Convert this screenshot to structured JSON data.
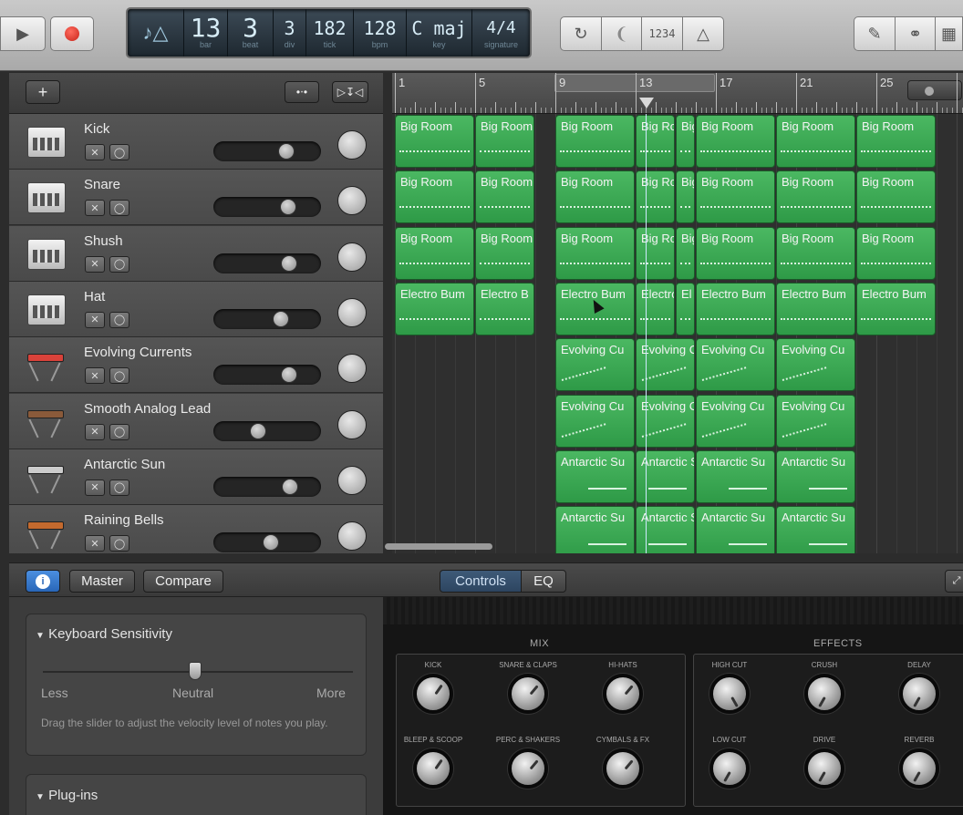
{
  "transport": {
    "play_icon": "play-icon",
    "record_icon": "record-icon"
  },
  "lcd": {
    "bar": {
      "value": "13",
      "label": "bar"
    },
    "beat": {
      "value": "3",
      "label": "beat"
    },
    "div": {
      "value": "3",
      "label": "div"
    },
    "tick": {
      "value": "182",
      "label": "tick"
    },
    "bpm": {
      "value": "128",
      "label": "bpm"
    },
    "key": {
      "value": "C maj",
      "label": "key"
    },
    "signature": {
      "value": "4/4",
      "label": "signature"
    }
  },
  "toolbar": {
    "count_in_label": "1234"
  },
  "ruler": {
    "bars": [
      "1",
      "5",
      "9",
      "13",
      "17",
      "21",
      "25"
    ]
  },
  "tracks": [
    {
      "name": "Kick",
      "volume": 0.72
    },
    {
      "name": "Snare",
      "volume": 0.74
    },
    {
      "name": "Shush",
      "volume": 0.76
    },
    {
      "name": "Hat",
      "volume": 0.66
    },
    {
      "name": "Evolving Currents",
      "volume": 0.75
    },
    {
      "name": "Smooth Analog Lead",
      "volume": 0.41
    },
    {
      "name": "Antarctic Sun",
      "volume": 0.77
    },
    {
      "name": "Raining Bells",
      "volume": 0.55
    }
  ],
  "regions": [
    {
      "track": 0,
      "label": "Big Room",
      "start": 1,
      "end": 5
    },
    {
      "track": 0,
      "label": "Big Room",
      "start": 5,
      "end": 8
    },
    {
      "track": 0,
      "label": "Big Room",
      "start": 9,
      "end": 13
    },
    {
      "track": 0,
      "label": "Big Room",
      "start": 13,
      "end": 15
    },
    {
      "track": 0,
      "label": "Big Room",
      "start": 15,
      "end": 16
    },
    {
      "track": 0,
      "label": "Big Room",
      "start": 16,
      "end": 20
    },
    {
      "track": 0,
      "label": "Big Room",
      "start": 20,
      "end": 24
    },
    {
      "track": 0,
      "label": "Big Room",
      "start": 24,
      "end": 28
    },
    {
      "track": 1,
      "label": "Big Room",
      "start": 1,
      "end": 5
    },
    {
      "track": 1,
      "label": "Big Room",
      "start": 5,
      "end": 8
    },
    {
      "track": 1,
      "label": "Big Room",
      "start": 9,
      "end": 13
    },
    {
      "track": 1,
      "label": "Big Room",
      "start": 13,
      "end": 15
    },
    {
      "track": 1,
      "label": "Big Room",
      "start": 15,
      "end": 16
    },
    {
      "track": 1,
      "label": "Big Room",
      "start": 16,
      "end": 20
    },
    {
      "track": 1,
      "label": "Big Room",
      "start": 20,
      "end": 24
    },
    {
      "track": 1,
      "label": "Big Room",
      "start": 24,
      "end": 28
    },
    {
      "track": 2,
      "label": "Big Room",
      "start": 1,
      "end": 5
    },
    {
      "track": 2,
      "label": "Big Room",
      "start": 5,
      "end": 8
    },
    {
      "track": 2,
      "label": "Big Room",
      "start": 9,
      "end": 13
    },
    {
      "track": 2,
      "label": "Big Room",
      "start": 13,
      "end": 15
    },
    {
      "track": 2,
      "label": "Big Room",
      "start": 15,
      "end": 16
    },
    {
      "track": 2,
      "label": "Big Room",
      "start": 16,
      "end": 20
    },
    {
      "track": 2,
      "label": "Big Room",
      "start": 20,
      "end": 24
    },
    {
      "track": 2,
      "label": "Big Room",
      "start": 24,
      "end": 28
    },
    {
      "track": 3,
      "label": "Electro Bum",
      "start": 1,
      "end": 5
    },
    {
      "track": 3,
      "label": "Electro B",
      "start": 5,
      "end": 8
    },
    {
      "track": 3,
      "label": "Electro Bum",
      "start": 9,
      "end": 13
    },
    {
      "track": 3,
      "label": "Electro B",
      "start": 13,
      "end": 15
    },
    {
      "track": 3,
      "label": "El",
      "start": 15,
      "end": 16
    },
    {
      "track": 3,
      "label": "Electro Bum",
      "start": 16,
      "end": 20
    },
    {
      "track": 3,
      "label": "Electro Bum",
      "start": 20,
      "end": 24
    },
    {
      "track": 3,
      "label": "Electro Bum",
      "start": 24,
      "end": 28
    },
    {
      "track": 4,
      "label": "Evolving Cu",
      "start": 9,
      "end": 13
    },
    {
      "track": 4,
      "label": "Evolving Cu",
      "start": 13,
      "end": 16
    },
    {
      "track": 4,
      "label": "Evolving Cu",
      "start": 16,
      "end": 20
    },
    {
      "track": 4,
      "label": "Evolving Cu",
      "start": 20,
      "end": 24
    },
    {
      "track": 5,
      "label": "Evolving Cu",
      "start": 9,
      "end": 13
    },
    {
      "track": 5,
      "label": "Evolving Cu",
      "start": 13,
      "end": 16
    },
    {
      "track": 5,
      "label": "Evolving Cu",
      "start": 16,
      "end": 20
    },
    {
      "track": 5,
      "label": "Evolving Cu",
      "start": 20,
      "end": 24
    },
    {
      "track": 6,
      "label": "Antarctic Su",
      "start": 9,
      "end": 13
    },
    {
      "track": 6,
      "label": "Antarctic Su",
      "start": 13,
      "end": 16
    },
    {
      "track": 6,
      "label": "Antarctic Su",
      "start": 16,
      "end": 20
    },
    {
      "track": 6,
      "label": "Antarctic Su",
      "start": 20,
      "end": 24
    },
    {
      "track": 7,
      "label": "Antarctic Su",
      "start": 9,
      "end": 13
    },
    {
      "track": 7,
      "label": "Antarctic Su",
      "start": 13,
      "end": 16
    },
    {
      "track": 7,
      "label": "Antarctic Su",
      "start": 16,
      "end": 20
    },
    {
      "track": 7,
      "label": "Antarctic Su",
      "start": 20,
      "end": 24
    }
  ],
  "smart_controls": {
    "master_label": "Master",
    "compare_label": "Compare",
    "tab_controls": "Controls",
    "tab_eq": "EQ"
  },
  "inspector": {
    "keyboard_sensitivity_title": "Keyboard Sensitivity",
    "less_label": "Less",
    "neutral_label": "Neutral",
    "more_label": "More",
    "help_text": "Drag the slider to adjust the velocity level of notes you play.",
    "sensitivity_value": 0.5,
    "plugins_title": "Plug-ins"
  },
  "instrument": {
    "mix_title": "MIX",
    "effects_title": "EFFECTS",
    "mix_knobs": [
      {
        "label": "KICK",
        "angle": 35
      },
      {
        "label": "SNARE & CLAPS",
        "angle": 40
      },
      {
        "label": "HI-HATS",
        "angle": 40
      },
      {
        "label": "BLEEP & SCOOP",
        "angle": 35
      },
      {
        "label": "PERC & SHAKERS",
        "angle": 40
      },
      {
        "label": "CYMBALS & FX",
        "angle": 40
      }
    ],
    "effects_knobs": [
      {
        "label": "HIGH CUT",
        "angle": 150
      },
      {
        "label": "CRUSH",
        "angle": -150
      },
      {
        "label": "DELAY",
        "angle": -150
      },
      {
        "label": "LOW CUT",
        "angle": -150
      },
      {
        "label": "DRIVE",
        "angle": -150
      },
      {
        "label": "REVERB",
        "angle": -150
      }
    ]
  }
}
